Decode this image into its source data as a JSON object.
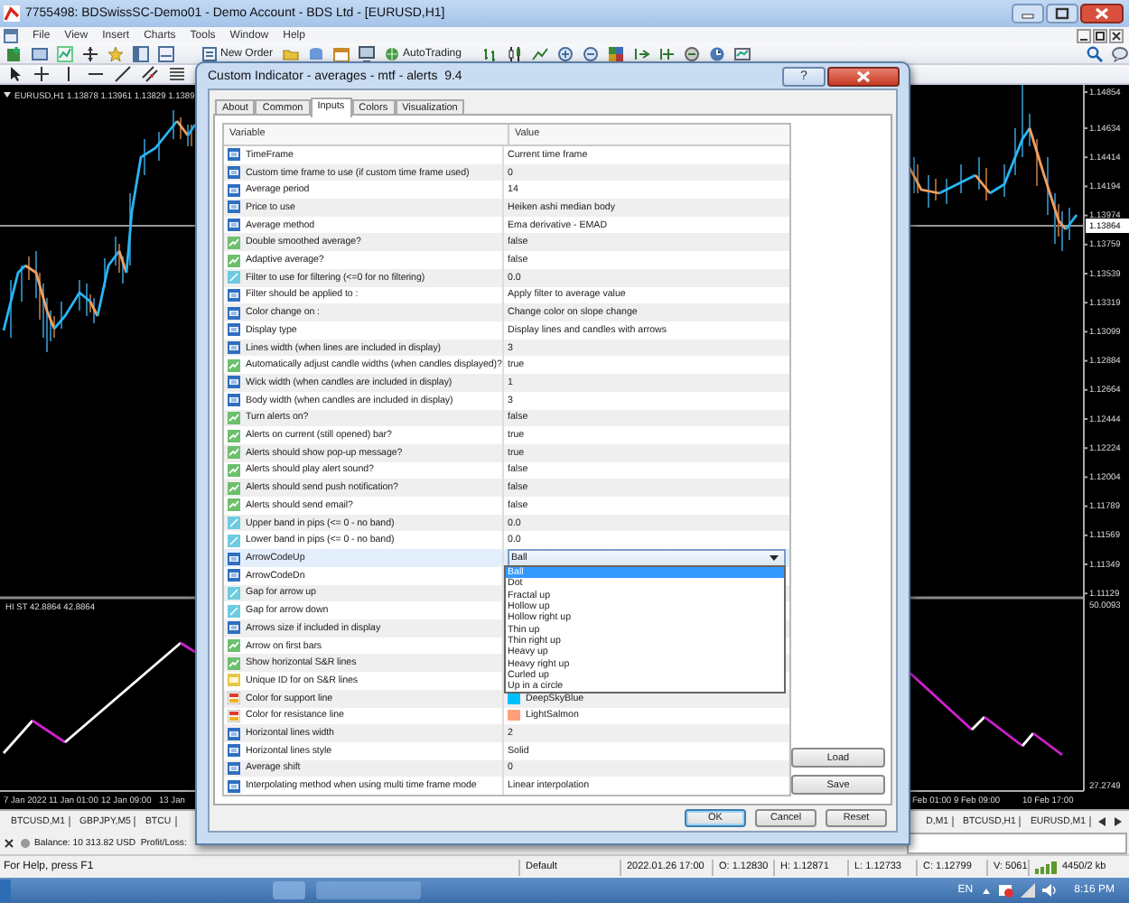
{
  "window": {
    "title": "7755498: BDSwissSC-Demo01 - Demo Account - BDS Ltd - [EURUSD,H1]"
  },
  "menu": [
    "File",
    "View",
    "Insert",
    "Charts",
    "Tools",
    "Window",
    "Help"
  ],
  "toolbar": {
    "buttons": [
      "New Order",
      "AutoTrading"
    ]
  },
  "chart": {
    "symbol_label": "EURUSD,H1 1.13878 1.13961 1.13829 1.1389",
    "indicator_label": "HI ST 42.8864 42.8864",
    "price_axis": [
      "1.14854",
      "1.14634",
      "1.14414",
      "1.14194",
      "1.13974",
      "1.13759",
      "1.13539",
      "1.13319",
      "1.13099",
      "1.12884",
      "1.12664",
      "1.12444",
      "1.12224",
      "1.12004",
      "1.11789",
      "1.11569",
      "1.11349",
      "1.11129"
    ],
    "bid_price": "1.13864",
    "oscillator_axis": [
      "50.0093",
      "27.2749"
    ],
    "time_axis_left": [
      "7 Jan 2022",
      "11 Jan 01:00",
      "12 Jan 09:00",
      "13 Jan"
    ],
    "time_axis_right": [
      "Feb 01:00",
      "9 Feb 09:00",
      "10 Feb 17:00"
    ]
  },
  "chart_tabs_left": [
    "BTCUSD,M1",
    "GBPJPY,M5",
    "BTCU"
  ],
  "chart_tabs_right": [
    "D,M1",
    "BTCUSD,H1",
    "EURUSD,M1"
  ],
  "terminal": {
    "balance": "Balance: 10 313.82 USD  Profit/Loss:"
  },
  "status_bar": {
    "help": "For Help, press F1",
    "fields": [
      "Default",
      "2022.01.26 17:00",
      "O: 1.12830",
      "H: 1.12871",
      "L: 1.12733",
      "C: 1.12799",
      "V: 5061",
      "4450/2 kb"
    ]
  },
  "taskbar": {
    "language": "EN",
    "clock": "8:16 PM"
  },
  "dialog": {
    "title": "Custom Indicator - averages - mtf - alerts  9.4",
    "help_button": "?",
    "tabs": [
      {
        "label": "About",
        "selected": false
      },
      {
        "label": "Common",
        "selected": false
      },
      {
        "label": "Inputs",
        "selected": true
      },
      {
        "label": "Colors",
        "selected": false
      },
      {
        "label": "Visualization",
        "selected": false
      }
    ],
    "columns": [
      "Variable",
      "Value"
    ],
    "rows": [
      {
        "name": "TimeFrame",
        "kind": "enum",
        "value": "Current time frame",
        "selected": false
      },
      {
        "name": "Custom time frame to use (if custom time frame used)",
        "kind": "enum",
        "value": "0",
        "selected": false
      },
      {
        "name": "Average period",
        "kind": "enum",
        "value": "14",
        "selected": false
      },
      {
        "name": "Price to use",
        "kind": "enum",
        "value": "Heiken ashi median body",
        "selected": false
      },
      {
        "name": "Average method",
        "kind": "enum",
        "value": "Ema derivative - EMAD",
        "selected": false
      },
      {
        "name": "Double smoothed average?",
        "kind": "bool",
        "value": "false",
        "selected": false
      },
      {
        "name": "Adaptive average?",
        "kind": "bool",
        "value": "false",
        "selected": false
      },
      {
        "name": "Filter to use for filtering (<=0 for no filtering)",
        "kind": "double",
        "value": "0.0",
        "selected": false
      },
      {
        "name": "Filter should be applied to :",
        "kind": "enum",
        "value": "Apply filter to average value",
        "selected": false
      },
      {
        "name": "Color change on :",
        "kind": "enum",
        "value": "Change color on slope change",
        "selected": false
      },
      {
        "name": "Display type",
        "kind": "enum",
        "value": "Display lines and candles with arrows",
        "selected": false
      },
      {
        "name": "Lines width (when lines are included in display)",
        "kind": "enum",
        "value": "3",
        "selected": false
      },
      {
        "name": "Automatically adjust candle widths (when candles displayed)?",
        "kind": "bool",
        "value": "true",
        "selected": false
      },
      {
        "name": "Wick width (when candles are included in display)",
        "kind": "enum",
        "value": "1",
        "selected": false
      },
      {
        "name": "Body width (when candles are included in display)",
        "kind": "enum",
        "value": "3",
        "selected": false
      },
      {
        "name": "Turn alerts on?",
        "kind": "bool",
        "value": "false",
        "selected": false
      },
      {
        "name": "Alerts on current (still opened) bar?",
        "kind": "bool",
        "value": "true",
        "selected": false
      },
      {
        "name": "Alerts should show pop-up message?",
        "kind": "bool",
        "value": "true",
        "selected": false
      },
      {
        "name": "Alerts should play alert sound?",
        "kind": "bool",
        "value": "false",
        "selected": false
      },
      {
        "name": "Alerts should send push notification?",
        "kind": "bool",
        "value": "false",
        "selected": false
      },
      {
        "name": "Alerts should send email?",
        "kind": "bool",
        "value": "false",
        "selected": false
      },
      {
        "name": "Upper band in pips (<= 0 - no band)",
        "kind": "double",
        "value": "0.0",
        "selected": false
      },
      {
        "name": "Lower band in pips (<= 0 - no band)",
        "kind": "double",
        "value": "0.0",
        "selected": false
      },
      {
        "name": "ArrowCodeUp",
        "kind": "enum",
        "value": "Ball",
        "selected": true,
        "dropdown": {
          "options": [
            {
              "label": "Ball",
              "selected": true
            },
            {
              "label": "Dot",
              "selected": false
            },
            {
              "label": "Fractal up",
              "selected": false
            },
            {
              "label": "Hollow up",
              "selected": false
            },
            {
              "label": "Hollow right up",
              "selected": false
            },
            {
              "label": "Thin up",
              "selected": false
            },
            {
              "label": "Thin right up",
              "selected": false
            },
            {
              "label": "Heavy up",
              "selected": false
            },
            {
              "label": "Heavy right up",
              "selected": false
            },
            {
              "label": "Curled up",
              "selected": false
            },
            {
              "label": "Up in a circle",
              "selected": false
            }
          ]
        }
      },
      {
        "name": "ArrowCodeDn",
        "kind": "enum",
        "selected": false
      },
      {
        "name": "Gap for arrow up",
        "kind": "double",
        "selected": false
      },
      {
        "name": "Gap for arrow down",
        "kind": "double",
        "selected": false
      },
      {
        "name": "Arrows size if included in display",
        "kind": "enum",
        "selected": false
      },
      {
        "name": "Arrow on first bars",
        "kind": "bool",
        "selected": false
      },
      {
        "name": "Show horizontal S&R lines",
        "kind": "bool",
        "selected": false
      },
      {
        "name": "Unique ID for on S&R lines",
        "kind": "string",
        "selected": false
      },
      {
        "name": "Color for support line",
        "kind": "color",
        "value": "DeepSkyBlue",
        "color": "#00bfff",
        "selected": false
      },
      {
        "name": "Color for resistance line",
        "kind": "color",
        "value": "LightSalmon",
        "color": "#ffa07a",
        "selected": false
      },
      {
        "name": "Horizontal lines width",
        "kind": "enum",
        "value": "2",
        "selected": false
      },
      {
        "name": "Horizontal lines style",
        "kind": "enum",
        "value": "Solid",
        "selected": false
      },
      {
        "name": "Average shift",
        "kind": "enum",
        "value": "0",
        "selected": false
      },
      {
        "name": "Interpolating method when using multi time frame mode",
        "kind": "enum",
        "value": "Linear interpolation",
        "selected": false
      }
    ],
    "side_buttons": [
      "Load",
      "Save"
    ],
    "buttons": [
      {
        "label": "OK",
        "default": true
      },
      {
        "label": "Cancel",
        "default": false
      },
      {
        "label": "Reset",
        "default": false
      }
    ]
  }
}
